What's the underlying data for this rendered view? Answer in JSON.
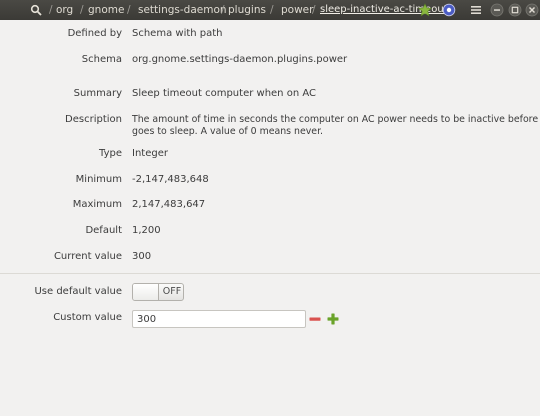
{
  "titlebar": {
    "breadcrumbs": [
      "/",
      "org",
      "/",
      "gnome",
      "/",
      "settings-daemon",
      "/",
      "plugins",
      "/",
      "power",
      "/",
      "sleep-inactive-ac-timeout"
    ]
  },
  "details": {
    "defined_by_label": "Defined by",
    "defined_by_value": "Schema with path",
    "schema_label": "Schema",
    "schema_value": "org.gnome.settings-daemon.plugins.power",
    "summary_label": "Summary",
    "summary_value": "Sleep timeout computer when on AC",
    "description_label": "Description",
    "description_line1": "The amount of time in seconds the computer on AC power needs to be inactive before it",
    "description_line2": "goes to sleep. A value of 0 means never.",
    "type_label": "Type",
    "type_value": "Integer",
    "minimum_label": "Minimum",
    "minimum_value": "-2,147,483,648",
    "maximum_label": "Maximum",
    "maximum_value": "2,147,483,647",
    "default_label": "Default",
    "default_value": "1,200",
    "current_label": "Current value",
    "current_value": "300"
  },
  "controls": {
    "use_default_label": "Use default value",
    "switch_state": "OFF",
    "custom_label": "Custom value",
    "custom_value": "300"
  },
  "colors": {
    "titlebar_bg": "#3b3a36",
    "star": "#8ab63f",
    "minus": "#d9524f",
    "plus": "#6aa329"
  }
}
